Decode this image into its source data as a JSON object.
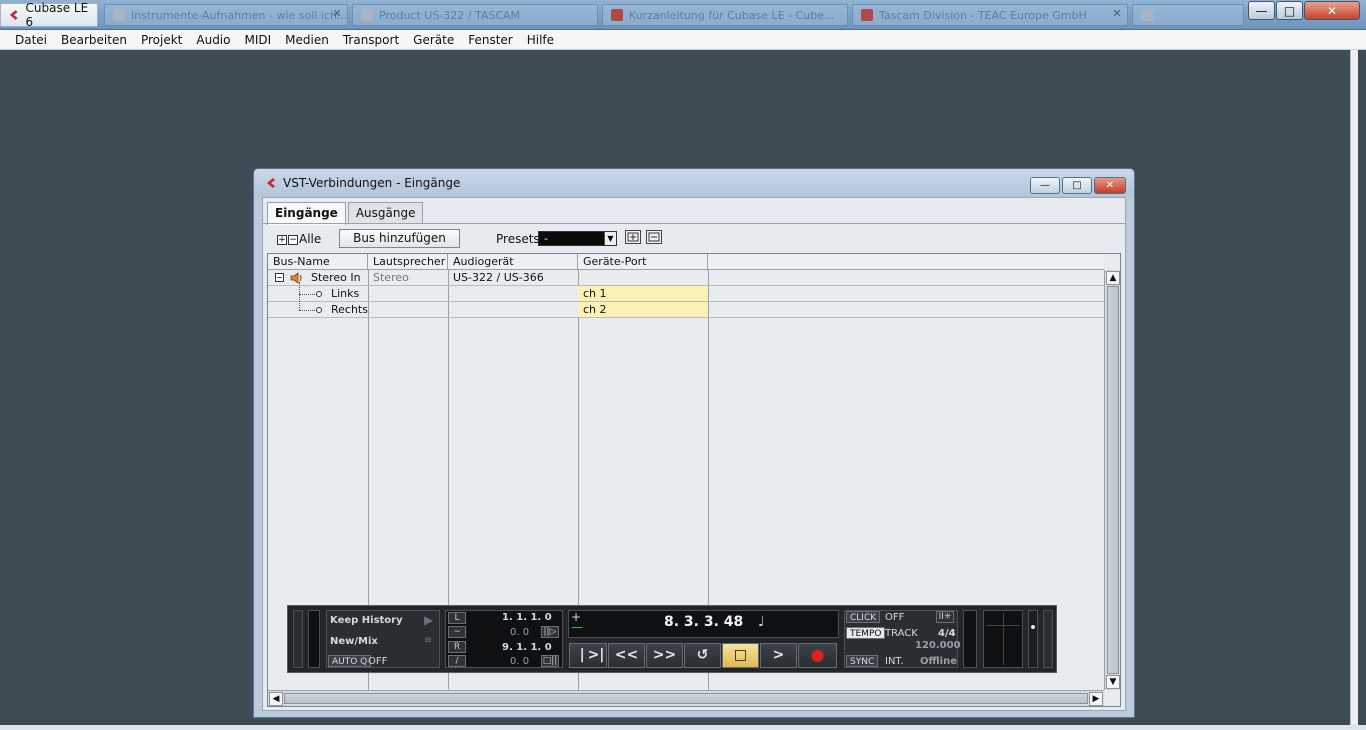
{
  "window": {
    "app_title": "Cubase LE 6",
    "taskbar_items": [
      {
        "label": "Instrumente-Aufnahmen - wie soll ich..."
      },
      {
        "label": "Product US-322 / TASCAM"
      },
      {
        "label": "Kurzanleitung für Cubase LE - Cube..."
      },
      {
        "label": "Tascam Division - TEAC Europe GmbH"
      }
    ],
    "controls": {
      "minimize": "—",
      "maximize": "□",
      "close": "✕"
    }
  },
  "menu": [
    "Datei",
    "Bearbeiten",
    "Projekt",
    "Audio",
    "MIDI",
    "Medien",
    "Transport",
    "Geräte",
    "Fenster",
    "Hilfe"
  ],
  "dialog": {
    "title": "VST-Verbindungen - Eingänge",
    "tabs": [
      {
        "label": "Eingänge",
        "active": true
      },
      {
        "label": "Ausgänge",
        "active": false
      }
    ],
    "toolbar": {
      "expand_all": "+",
      "collapse_all": "−",
      "all_label": "Alle",
      "add_bus": "Bus hinzufügen",
      "presets_label": "Presets",
      "presets_value": "-"
    },
    "columns": [
      "Bus-Name",
      "Lautsprecher",
      "Audiogerät",
      "Geräte-Port"
    ],
    "rows": [
      {
        "name": "Stereo In",
        "speaker": "Stereo",
        "device": "US-322 / US-366",
        "port": ""
      },
      {
        "name": "Links",
        "speaker": "",
        "device": "",
        "port": "ch 1"
      },
      {
        "name": "Rechts",
        "speaker": "",
        "device": "",
        "port": "ch 2"
      }
    ]
  },
  "transport": {
    "keep_history": "Keep History",
    "new_mix": "New/Mix",
    "auto_q_label": "AUTO Q",
    "auto_q_value": "OFF",
    "left_locator": "1. 1. 1.   0",
    "left_sub": "0.   0",
    "right_locator": "9. 1. 1.   0",
    "right_sub": "0.   0",
    "position": "8.  3.  3.  48",
    "click_label": "CLICK",
    "click_value": "OFF",
    "tempo_label": "TEMPO",
    "tempo_mode": "TRACK",
    "signature": "4/4",
    "tempo_value": "120.000",
    "sync_label": "SYNC",
    "sync_mode": "INT.",
    "sync_status": "Offline",
    "buttons": [
      "|<",
      ">|",
      "<<",
      ">>",
      "↺",
      "□",
      ">",
      "●"
    ]
  }
}
